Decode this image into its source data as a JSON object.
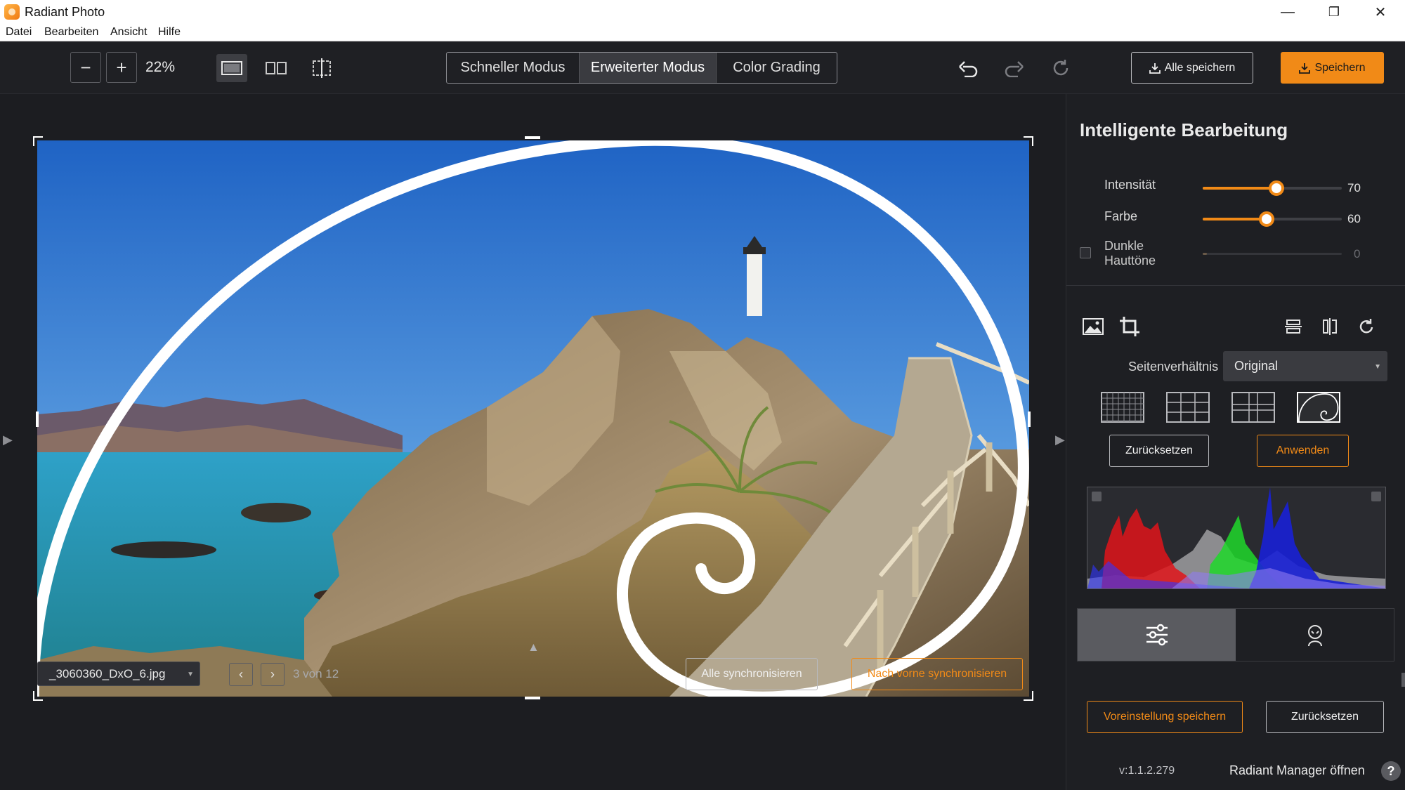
{
  "window": {
    "title": "Radiant Photo",
    "minimize": "—",
    "maximize": "❐",
    "close": "✕"
  },
  "menu": [
    "Datei",
    "Bearbeiten",
    "Ansicht",
    "Hilfe"
  ],
  "toolbar": {
    "zoom_out": "−",
    "zoom_in": "+",
    "zoom_value": "22%",
    "modes": [
      "Schneller Modus",
      "Erweiterter Modus",
      "Color Grading"
    ],
    "active_mode": "Erweiterter Modus",
    "save_all": "Alle speichern",
    "save": "Speichern"
  },
  "bottom": {
    "filename": "_3060360_DxO_6.jpg",
    "prev": "‹",
    "next": "›",
    "counter": "3 von 12",
    "sync_all": "Alle synchronisieren",
    "sync_forward": "Nach vorne synchronisieren"
  },
  "panel": {
    "title": "Intelligente Bearbeitung",
    "sliders": [
      {
        "label": "Intensität",
        "value": 70,
        "value_text": "70",
        "fraction": 0.53
      },
      {
        "label": "Farbe",
        "value": 60,
        "value_text": "60",
        "fraction": 0.46
      },
      {
        "label_line1": "Dunkle",
        "label_line2": "Hauttöne",
        "value": 0,
        "value_text": "0",
        "fraction": 0.03,
        "enabled": false
      }
    ],
    "aspect_label": "Seitenverhältnis",
    "aspect_value": "Original",
    "overlay_options": [
      "fine-grid",
      "grid-3x3",
      "grid-phi",
      "golden-spiral"
    ],
    "active_overlay": "golden-spiral",
    "reset": "Zurücksetzen",
    "apply": "Anwenden",
    "save_preset": "Voreinstellung speichern",
    "reset2": "Zurücksetzen",
    "version": "v:1.1.2.279",
    "manager": "Radiant Manager öffnen",
    "help": "?"
  },
  "colors": {
    "accent": "#f18a17",
    "background": "#1c1d21",
    "panel": "#1e1f23"
  }
}
